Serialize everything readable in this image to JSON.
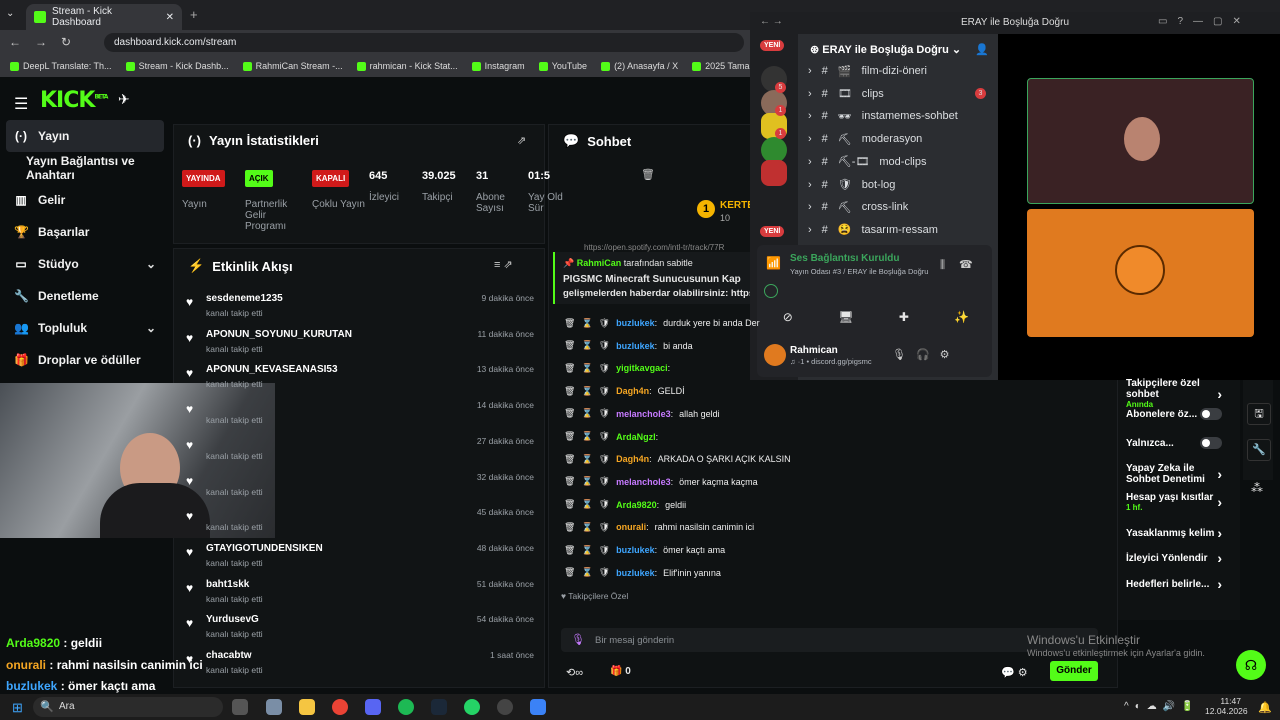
{
  "browser": {
    "tab_title": "Stream - Kick Dashboard",
    "url": "dashboard.kick.com/stream",
    "bookmarks": [
      "DeepL Translate: Th...",
      "Stream - Kick Dashb...",
      "RahmiCan Stream -...",
      "rahmican - Kick Stat...",
      "Instagram",
      "YouTube",
      "(2) Anasayfa / X",
      "2025 Tamamlayıcı S..."
    ]
  },
  "kick": {
    "logo": "KICK",
    "logo_beta": "BETA",
    "nav": [
      {
        "label": "Yayın",
        "icon": "broadcast-icon"
      },
      {
        "label": "Yayın Bağlantısı ve Anahtarı",
        "icon": ""
      },
      {
        "label": "Gelir",
        "icon": "chart-icon"
      },
      {
        "label": "Başarılar",
        "icon": "trophy-icon"
      },
      {
        "label": "Stüdyo",
        "icon": "monitor-icon"
      },
      {
        "label": "Denetleme",
        "icon": "wrench-icon"
      },
      {
        "label": "Topluluk",
        "icon": "people-icon"
      },
      {
        "label": "Droplar ve ödüller",
        "icon": "gift-icon"
      }
    ],
    "stats": {
      "title": "Yayın İstatistikleri",
      "items": [
        {
          "value": "YAYINDA",
          "label": "Yayın",
          "color": "#d01a1a"
        },
        {
          "value": "AÇIK",
          "label": "Partnerlik Gelir Programı",
          "color": "#53fc18"
        },
        {
          "value": "KAPALI",
          "label": "Çoklu Yayın",
          "color": "#d01a1a"
        },
        {
          "value": "645",
          "label": "İzleyici"
        },
        {
          "value": "39.025",
          "label": "Takipçi"
        },
        {
          "value": "31",
          "label": "Abone Sayısı"
        },
        {
          "value": "01:5",
          "label": "Yay Old Sür"
        }
      ]
    },
    "feed": {
      "title": "Etkinlik Akışı",
      "sub": "kanalı takip etti",
      "items": [
        {
          "name": "sesdeneme1235",
          "time": "9 dakika önce"
        },
        {
          "name": "APONUN_SOYUNU_KURUTAN",
          "time": "11 dakika önce"
        },
        {
          "name": "APONUN_KEVASEANASI53",
          "time": "13 dakika önce"
        },
        {
          "name": "",
          "time": "14 dakika önce"
        },
        {
          "name": "",
          "time": "27 dakika önce"
        },
        {
          "name": "",
          "time": "32 dakika önce"
        },
        {
          "name": "",
          "time": "45 dakika önce"
        },
        {
          "name": "GTAYIGOTUNDENSIKEN",
          "time": "48 dakika önce"
        },
        {
          "name": "baht1skk",
          "time": "51 dakika önce"
        },
        {
          "name": "YurdusevG",
          "time": "54 dakika önce"
        },
        {
          "name": "chacabtw",
          "time": "1 saat önce"
        }
      ]
    },
    "chat": {
      "title": "Sohbet",
      "pinned_user": "RahmiCan",
      "pinned_by": "tarafından sabitle",
      "pinned_msg": "PIGSMC Minecraft Sunucusunun Kap",
      "pinned_msg2": "gelişmelerden haberdar olabilirsiniz: https",
      "link": "https://open.spotify.com/intl-tr/track/77R",
      "kerte": "KERTE",
      "kerte_n": "10",
      "messages": [
        {
          "u": "buzlukek",
          "c": "#3ea6ff",
          "m": "durduk yere bi anda Der"
        },
        {
          "u": "buzlukek",
          "c": "#3ea6ff",
          "m": "bi anda"
        },
        {
          "u": "yigitkavgaci",
          "c": "#53fc18",
          "m": ""
        },
        {
          "u": "Dagh4n",
          "c": "#f5a623",
          "m": "GELDİ"
        },
        {
          "u": "melancholе3",
          "c": "#c67aff",
          "m": "allah geldi"
        },
        {
          "u": "ArdaNgzl",
          "c": "#53fc18",
          "m": ""
        },
        {
          "u": "Dagh4n",
          "c": "#f5a623",
          "m": "ARKADA O ŞARKI AÇIK KALSIN"
        },
        {
          "u": "melancholе3",
          "c": "#c67aff",
          "m": "ömer kaçma kaçma"
        },
        {
          "u": "Arda9820",
          "c": "#53fc18",
          "m": "geldii"
        },
        {
          "u": "onurali",
          "c": "#f5a623",
          "m": "rahmi nasilsin canimin ici"
        },
        {
          "u": "buzlukek",
          "c": "#3ea6ff",
          "m": "ömer kaçtı ama"
        },
        {
          "u": "buzlukek",
          "c": "#3ea6ff",
          "m": "Elif'inin yanına"
        }
      ],
      "followers_only": "Takipçilere Özel",
      "placeholder": "Bir mesaj gönderin",
      "send": "Gönder",
      "count": "0"
    },
    "right": [
      {
        "label": "Takipçilere özel sohbet",
        "sub": "Anında"
      },
      {
        "label": "Abonelere öz..."
      },
      {
        "label": "Yalnızca..."
      },
      {
        "label": "Yapay Zeka ile Sohbet Denetimi"
      },
      {
        "label": "Hesap yaşı kısıtlar",
        "sub": "1 hf."
      },
      {
        "label": "Yasaklanmış kelim"
      },
      {
        "label": "İzleyici Yönlendir"
      },
      {
        "label": "Hedefleri belirle..."
      }
    ],
    "windows": {
      "line1": "Windows'u Etkinleştir",
      "line2": "Windows'u etkinleştirmek için Ayarlar'a gidin."
    }
  },
  "overlay_chat": [
    {
      "u": "Arda9820",
      "c": "#53fc18",
      "m": "geldii"
    },
    {
      "u": "onurali",
      "c": "#f5a623",
      "m": "rahmi nasilsin canimin ici"
    },
    {
      "u": "buzlukek",
      "c": "#3ea6ff",
      "m": "ömer kaçtı ama"
    }
  ],
  "discord": {
    "window_title": "ERAY ile Boşluğa Doğru",
    "server": "ERAY ile Boşluğa Doğru",
    "new_badge": "YENİ",
    "channels": [
      {
        "name": "film-dizi-öneri",
        "emoji": "🎬"
      },
      {
        "name": "clips",
        "emoji": "🎞"
      },
      {
        "name": "instamemes-sohbet",
        "emoji": "🕶"
      },
      {
        "name": "moderasyon",
        "emoji": "⛏"
      },
      {
        "name": "mod-clips",
        "emoji": "⛏-🎞"
      },
      {
        "name": "bot-log",
        "emoji": "🛡"
      },
      {
        "name": "cross-link",
        "emoji": "⛏"
      },
      {
        "name": "tasarım-ressam",
        "emoji": "😫"
      }
    ],
    "clips_unread": "3",
    "voice_status": "Ses Bağlantısı Kuruldu",
    "voice_channel": "Yayın Odası #3 / ERAY ile Boşluğa Doğru",
    "user": "Rahmican",
    "user_sub": "♫ ·1 • discord.gg/pigsmc",
    "server_badges": [
      "5",
      "1",
      "1"
    ]
  },
  "taskbar": {
    "search": "Ara",
    "time": "11:47",
    "date": "12.04.2026"
  }
}
